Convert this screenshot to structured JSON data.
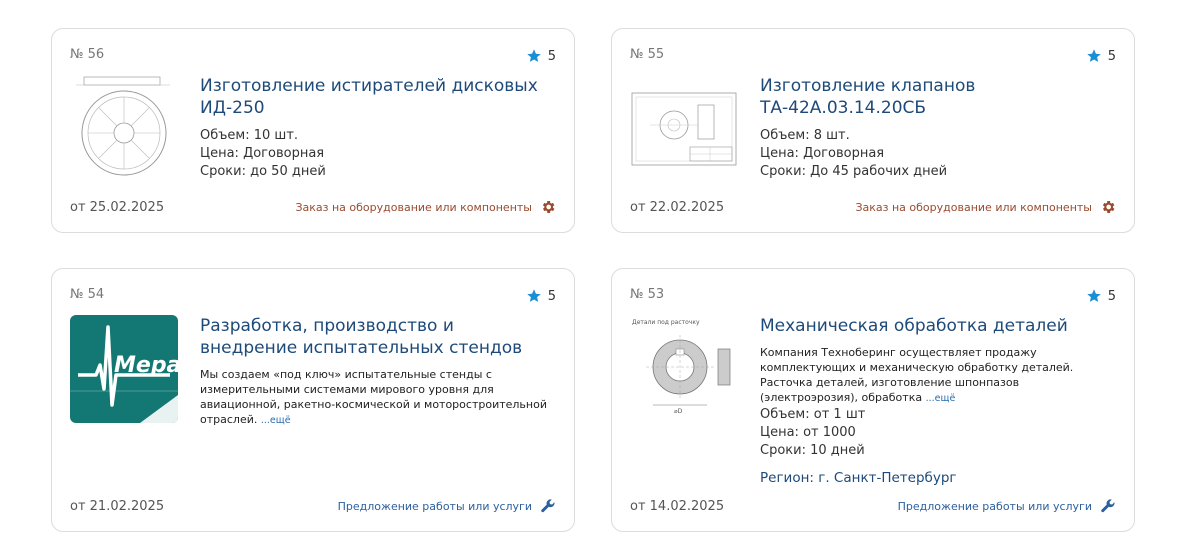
{
  "cards": [
    {
      "number": "№ 56",
      "rating": "5",
      "title": "Изготовление истирателей дисковых ИД-250",
      "volume": "Объем: 10 шт.",
      "price": "Цена: Договорная",
      "terms": "Сроки: до 50 дней",
      "date": "от 25.02.2025",
      "category": "Заказ на оборудование или компоненты",
      "category_icon": "gear-icon"
    },
    {
      "number": "№ 55",
      "rating": "5",
      "title": "Изготовление клапанов ТА-42А.03.14.20СБ",
      "volume": "Объем: 8 шт.",
      "price": "Цена: Договорная",
      "terms": "Сроки: До 45 рабочих дней",
      "date": "от 22.02.2025",
      "category": "Заказ на оборудование или компоненты",
      "category_icon": "gear-icon"
    },
    {
      "number": "№ 54",
      "rating": "5",
      "title": "Разработка, производство и внедрение испытательных стендов",
      "description": "Мы создаем «под ключ» испытательные стенды с измерительными системами мирового уровня для авиационной, ракетно-космической и моторостроительной отраслей.",
      "more": "...ещё",
      "logo_text": "Мера",
      "date": "от 21.02.2025",
      "category": "Предложение работы или услуги",
      "category_icon": "wrench-icon"
    },
    {
      "number": "№ 53",
      "rating": "5",
      "title": "Механическая обработка деталей",
      "description": "Компания Техноберинг осуществляет продажу комплектующих и механическую обработку деталей. Расточка деталей, изготовление шпонпазов (электроэрозия), обработка",
      "more": "...ещё",
      "volume": "Объем: от 1 шт",
      "price": "Цена: от 1000",
      "terms": "Сроки: 10 дней",
      "region": "Регион: г. Санкт-Петербург",
      "drawing_caption": "Детали под расточку",
      "date": "от 14.02.2025",
      "category": "Предложение работы или услуги",
      "category_icon": "wrench-icon"
    }
  ],
  "colors": {
    "title": "#1d4a7a",
    "star": "#1a8fd6",
    "order_category": "#9a4a2e",
    "offer_category": "#2b5f9e",
    "mera_logo_bg": "#137873"
  }
}
